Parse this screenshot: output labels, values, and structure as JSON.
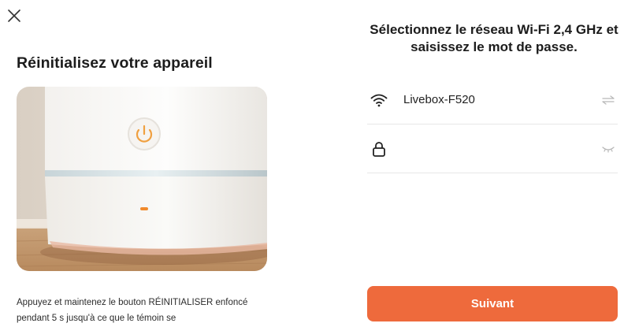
{
  "left": {
    "close_icon": "close-icon",
    "title": "Réinitialisez votre appareil",
    "description": "Appuyez et maintenez le bouton RÉINITIALISER enfoncé pendant 5 s jusqu'à ce que le témoin se"
  },
  "right": {
    "title": "Sélectionnez le réseau Wi-Fi 2,4 GHz et saisissez le mot de passe.",
    "ssid": {
      "icon": "wifi-icon",
      "value": "Livebox-F520",
      "switch_icon": "swap-network-icon"
    },
    "password": {
      "icon": "lock-icon",
      "value": "",
      "placeholder": "",
      "toggle_icon": "hidden-eye-icon"
    },
    "next_label": "Suivant"
  },
  "colors": {
    "accent": "#ee6a3c",
    "led": "#f08a2c",
    "text": "#1c1c1c",
    "divider": "#e7e7e7"
  }
}
